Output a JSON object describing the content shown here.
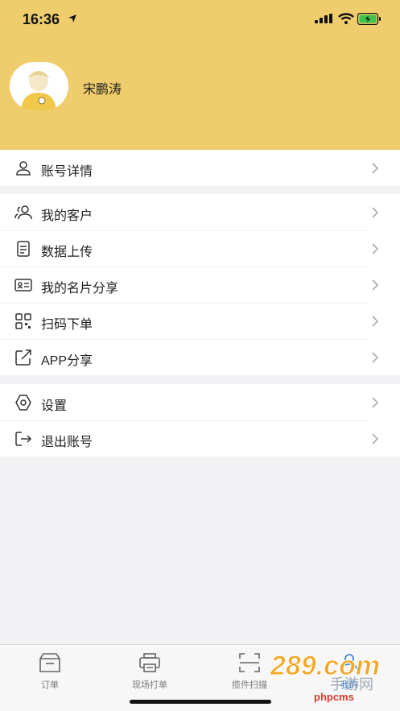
{
  "status_bar": {
    "time": "16:36"
  },
  "profile": {
    "name": "宋鹏涛"
  },
  "menu_groups": [
    [
      {
        "label": "账号详情",
        "icon": "person-icon"
      }
    ],
    [
      {
        "label": "我的客户",
        "icon": "customers-icon"
      },
      {
        "label": "数据上传",
        "icon": "document-icon"
      },
      {
        "label": "我的名片分享",
        "icon": "id-card-icon"
      },
      {
        "label": "扫码下单",
        "icon": "qr-code-icon"
      },
      {
        "label": "APP分享",
        "icon": "share-icon"
      }
    ],
    [
      {
        "label": "设置",
        "icon": "gear-icon"
      },
      {
        "label": "退出账号",
        "icon": "logout-icon"
      }
    ]
  ],
  "tabbar": [
    {
      "label": "订单",
      "icon": "orders-icon",
      "active": false
    },
    {
      "label": "现场打单",
      "icon": "printer-icon",
      "active": false
    },
    {
      "label": "揽件扫描",
      "icon": "scan-icon",
      "active": false
    },
    {
      "label": "我的",
      "icon": "mine-icon",
      "active": true
    }
  ],
  "watermark": {
    "logo_text": "289.com",
    "site": "phpcms"
  },
  "colors": {
    "header": "#efcc6c",
    "active_tab": "#2f7bd8",
    "background": "#f2f2f4"
  }
}
